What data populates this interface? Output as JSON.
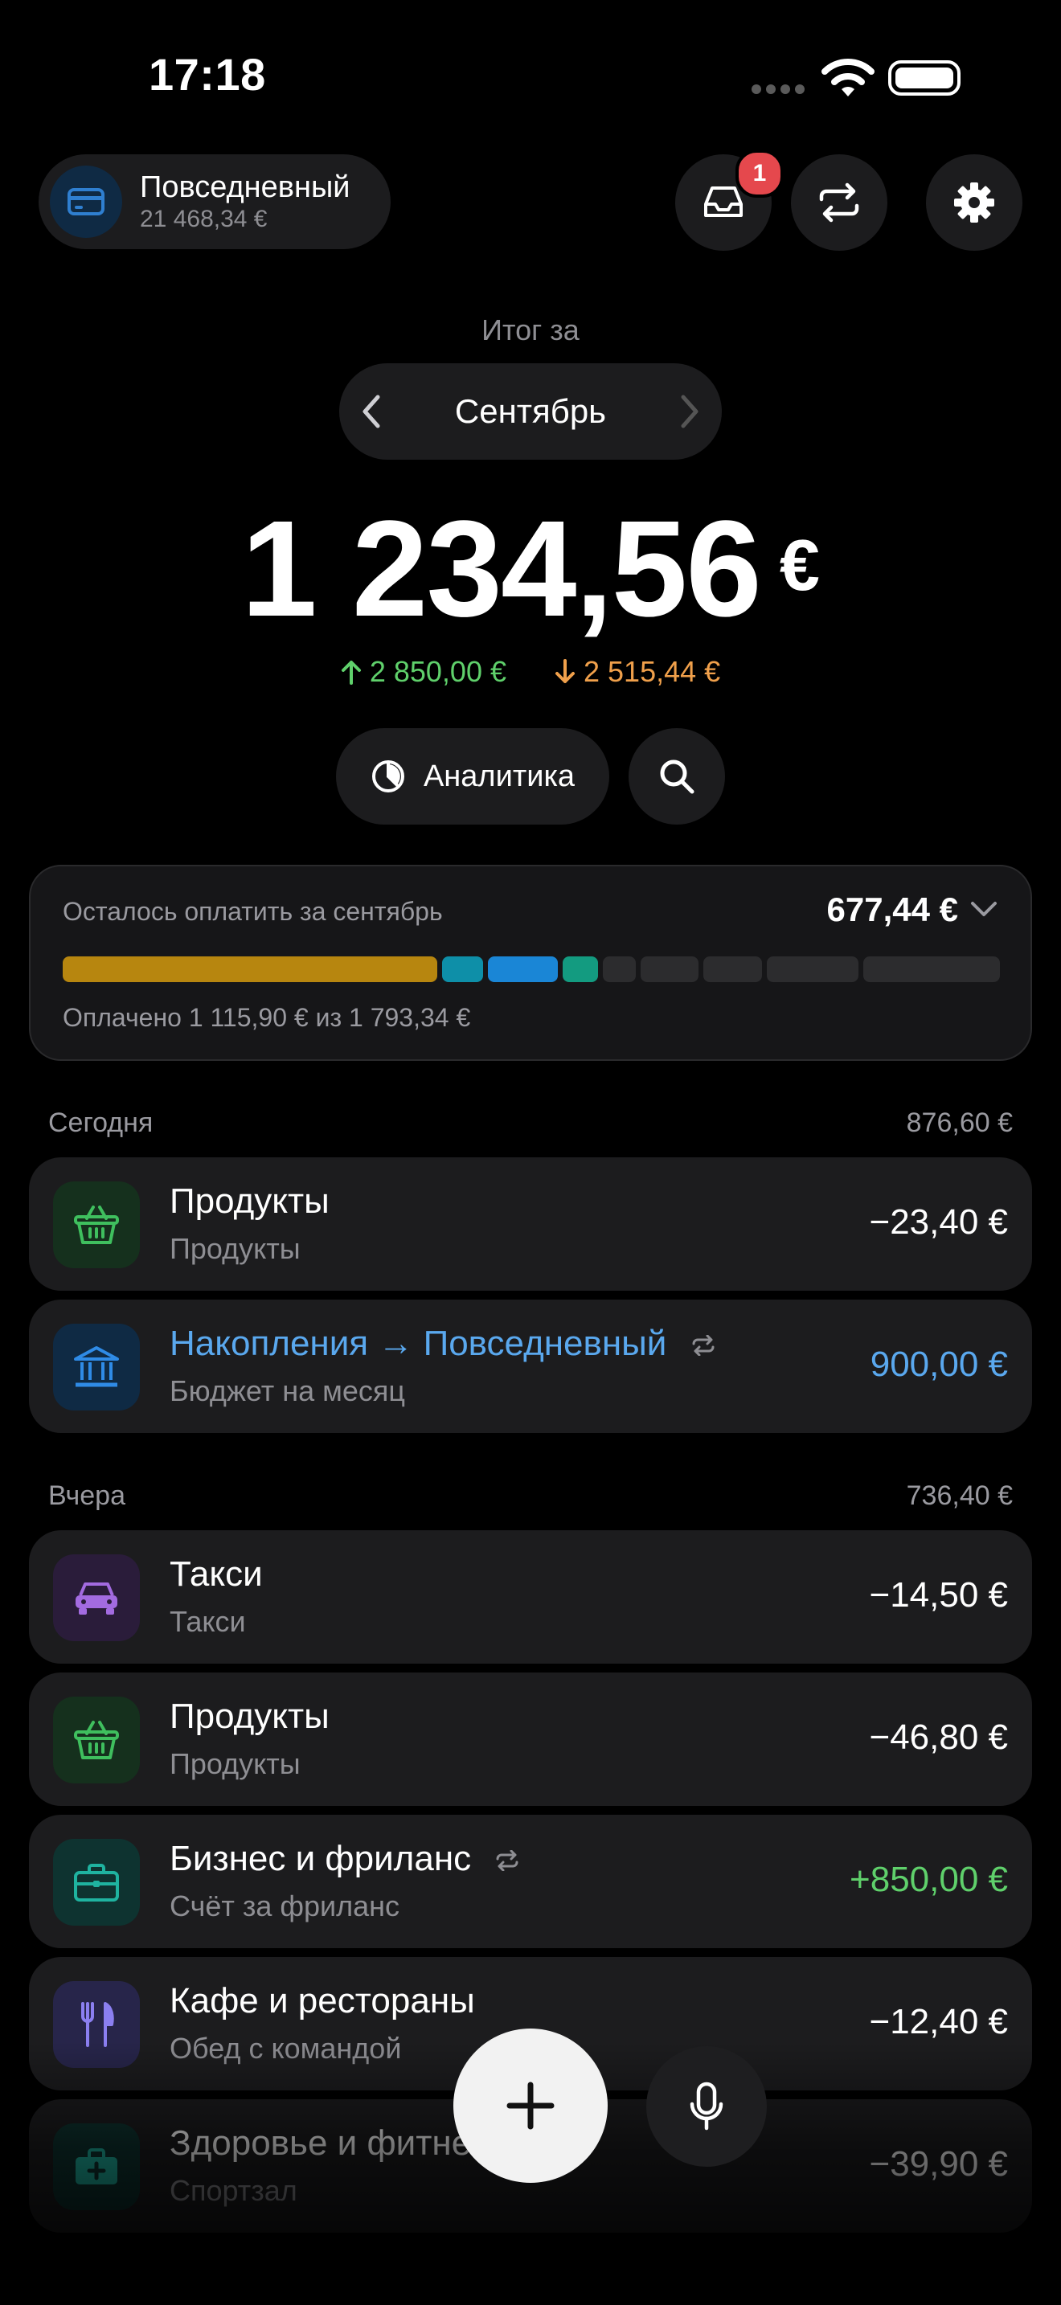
{
  "status_bar": {
    "time": "17:18"
  },
  "account": {
    "name": "Повседневный",
    "balance": "21 468,34 €"
  },
  "notifications": {
    "badge_count": "1"
  },
  "summary": {
    "label": "Итог за",
    "month": "Сентябрь",
    "total": "1 234,56",
    "currency": "€",
    "income": "2 850,00 €",
    "expense": "2 515,44 €"
  },
  "actions": {
    "analytics_label": "Аналитика"
  },
  "budget": {
    "title": "Осталось оплатить за сентябрь",
    "remaining": "677,44 €",
    "paid_text": "Оплачено 1 115,90 € из 1 793,34 €",
    "segments": [
      {
        "color": "#b7860f",
        "share": 0.41
      },
      {
        "color": "#0e8fa8",
        "share": 0.045
      },
      {
        "color": "#1a86d6",
        "share": 0.077
      },
      {
        "color": "#139b80",
        "share": 0.038
      },
      {
        "color": "#2c2c2e",
        "share": 0.036
      },
      {
        "color": "#2c2c2e",
        "share": 0.064
      },
      {
        "color": "#2c2c2e",
        "share": 0.064
      },
      {
        "color": "#2c2c2e",
        "share": 0.1
      },
      {
        "color": "#2c2c2e",
        "share": 0.15
      }
    ]
  },
  "sections": [
    {
      "title": "Сегодня",
      "total": "876,60 €",
      "items": [
        {
          "icon": "basket-icon",
          "title": "Продукты",
          "subtitle": "Продукты",
          "amount": "−23,40 €"
        },
        {
          "icon": "bank-icon",
          "title": "Накопления → Повседневный",
          "subtitle": "Бюджет на месяц",
          "amount": "900,00 €"
        }
      ]
    },
    {
      "title": "Вчера",
      "total": "736,40 €",
      "items": [
        {
          "icon": "car-icon",
          "title": "Такси",
          "subtitle": "Такси",
          "amount": "−14,50 €"
        },
        {
          "icon": "basket-icon",
          "title": "Продукты",
          "subtitle": "Продукты",
          "amount": "−46,80 €"
        },
        {
          "icon": "briefcase-icon",
          "title": "Бизнес и фриланс",
          "subtitle": "Счёт за фриланс",
          "amount": "+850,00 €"
        },
        {
          "icon": "cutlery-icon",
          "title": "Кафе и рестораны",
          "subtitle": "Обед с командой",
          "amount": "−12,40 €"
        },
        {
          "icon": "medkit-icon",
          "title": "Здоровье и фитнес",
          "subtitle": "Спортзал",
          "amount": "−39,90 €"
        }
      ]
    }
  ],
  "colors": {
    "income": "#5fd06b",
    "expense": "#f0a04b",
    "transfer": "#5aa8ee",
    "background": "#000000",
    "card": "#1c1c1e"
  }
}
